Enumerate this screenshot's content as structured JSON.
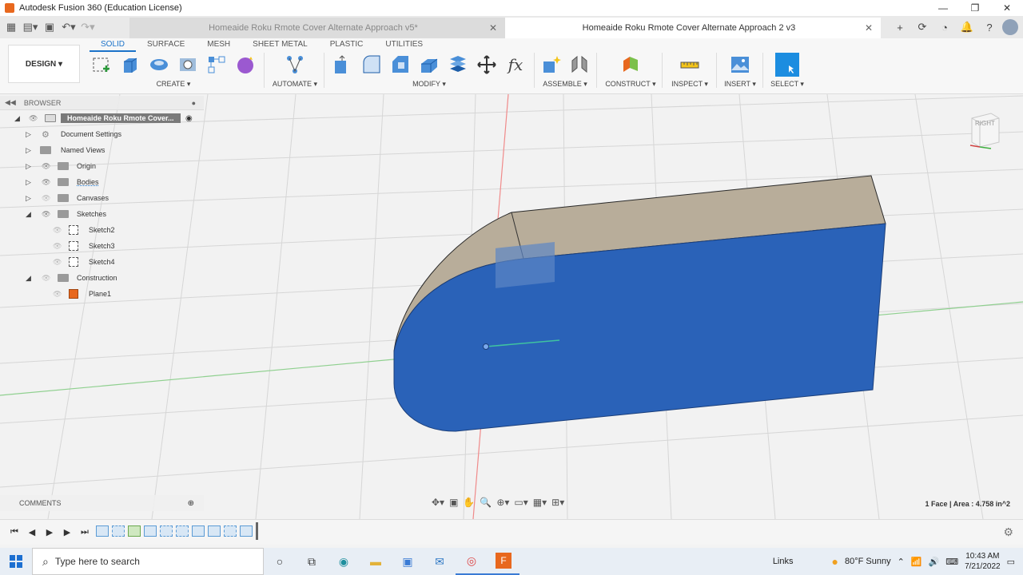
{
  "window": {
    "title": "Autodesk Fusion 360 (Education License)"
  },
  "tabs": [
    {
      "label": "Homeaide Roku Rmote Cover Alternate Approach v5*"
    },
    {
      "label": "Homeaide Roku Rmote Cover Alternate Approach 2 v3"
    }
  ],
  "toolbar": {
    "design_label": "DESIGN ▾",
    "modes": [
      "SOLID",
      "SURFACE",
      "MESH",
      "SHEET METAL",
      "PLASTIC",
      "UTILITIES"
    ],
    "groups": {
      "create": "CREATE ▾",
      "automate": "AUTOMATE ▾",
      "modify": "MODIFY ▾",
      "assemble": "ASSEMBLE ▾",
      "construct": "CONSTRUCT ▾",
      "inspect": "INSPECT ▾",
      "insert": "INSERT ▾",
      "select": "SELECT ▾"
    }
  },
  "browser": {
    "header": "BROWSER",
    "root": "Homeaide Roku Rmote Cover...",
    "items": [
      {
        "label": "Document Settings"
      },
      {
        "label": "Named Views"
      },
      {
        "label": "Origin"
      },
      {
        "label": "Bodies"
      },
      {
        "label": "Canvases"
      },
      {
        "label": "Sketches"
      },
      {
        "label": "Sketch2"
      },
      {
        "label": "Sketch3"
      },
      {
        "label": "Sketch4"
      },
      {
        "label": "Construction"
      },
      {
        "label": "Plane1"
      }
    ]
  },
  "viewcube": {
    "face": "RIGHT"
  },
  "comments": {
    "label": "COMMENTS"
  },
  "status": {
    "selection": "1 Face | Area : 4.758 in^2"
  },
  "taskbar": {
    "search_placeholder": "Type here to search",
    "links": "Links",
    "weather": "80°F  Sunny",
    "time": "10:43 AM",
    "date": "7/21/2022"
  },
  "colors": {
    "accent": "#1b73c9",
    "face_select": "#2a62b8",
    "body_top": "#b8ad9a"
  }
}
